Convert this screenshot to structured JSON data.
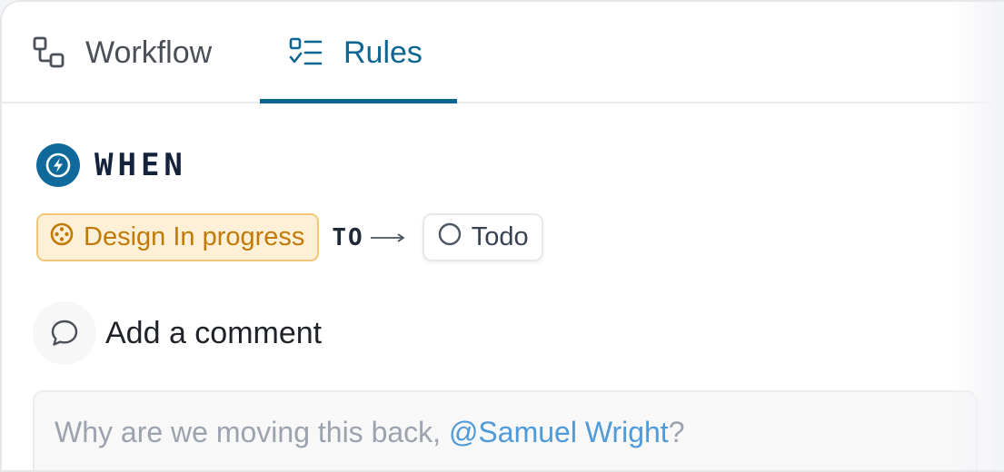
{
  "tabs": [
    {
      "label": "Workflow",
      "icon": "workflow-icon",
      "active": false
    },
    {
      "label": "Rules",
      "icon": "rules-checklist-icon",
      "active": true
    }
  ],
  "trigger": {
    "label": "WHEN",
    "icon": "lightning-bolt-icon"
  },
  "transition": {
    "from": {
      "label": "Design In progress",
      "icon": "in-progress-status-icon",
      "color": "#c27a07"
    },
    "connector": "TO",
    "to": {
      "label": "Todo",
      "icon": "todo-circle-icon"
    }
  },
  "comment": {
    "title": "Add a comment",
    "icon": "speech-bubble-icon",
    "placeholder_prefix": "Why are we moving this back, ",
    "mention": "@Samuel Wright",
    "placeholder_suffix": "?"
  },
  "colors": {
    "accent": "#0d6591",
    "warning": "#c27a07"
  }
}
